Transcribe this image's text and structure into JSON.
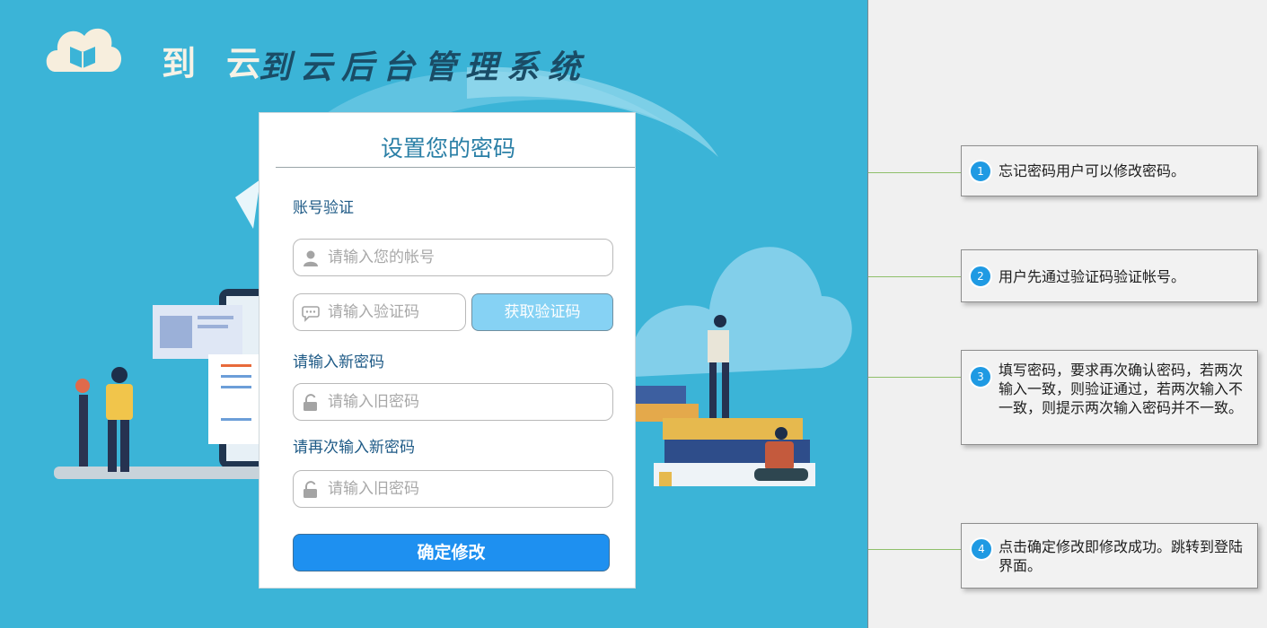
{
  "header": {
    "brand": "到云",
    "title": "到云后台管理系统"
  },
  "form": {
    "title": "设置您的密码",
    "section_account": "账号验证",
    "account_placeholder": "请输入您的帐号",
    "code_placeholder": "请输入验证码",
    "get_code_label": "获取验证码",
    "section_new_password": "请输入新密码",
    "new_password_placeholder": "请输入旧密码",
    "section_confirm_password": "请再次输入新密码",
    "confirm_password_placeholder": "请输入旧密码",
    "submit_label": "确定修改"
  },
  "annotations": [
    {
      "number": "1",
      "text": "忘记密码用户可以修改密码。"
    },
    {
      "number": "2",
      "text": "用户先通过验证码验证帐号。"
    },
    {
      "number": "3",
      "text": "填写密码，要求再次确认密码，若两次输入一致，则验证通过，若两次输入不一致，则提示两次输入密码并不一致。"
    },
    {
      "number": "4",
      "text": "点击确定修改即修改成功。跳转到登陆界面。"
    }
  ],
  "colors": {
    "background": "#3bb4d7",
    "title": "#1a4c66",
    "primary_button": "#1e90f0",
    "code_button": "#86d2f4",
    "badge": "#1f9ae3"
  },
  "icons": [
    "cloud-book-logo-icon",
    "user-icon",
    "chat-bubble-icon",
    "lock-icon"
  ]
}
